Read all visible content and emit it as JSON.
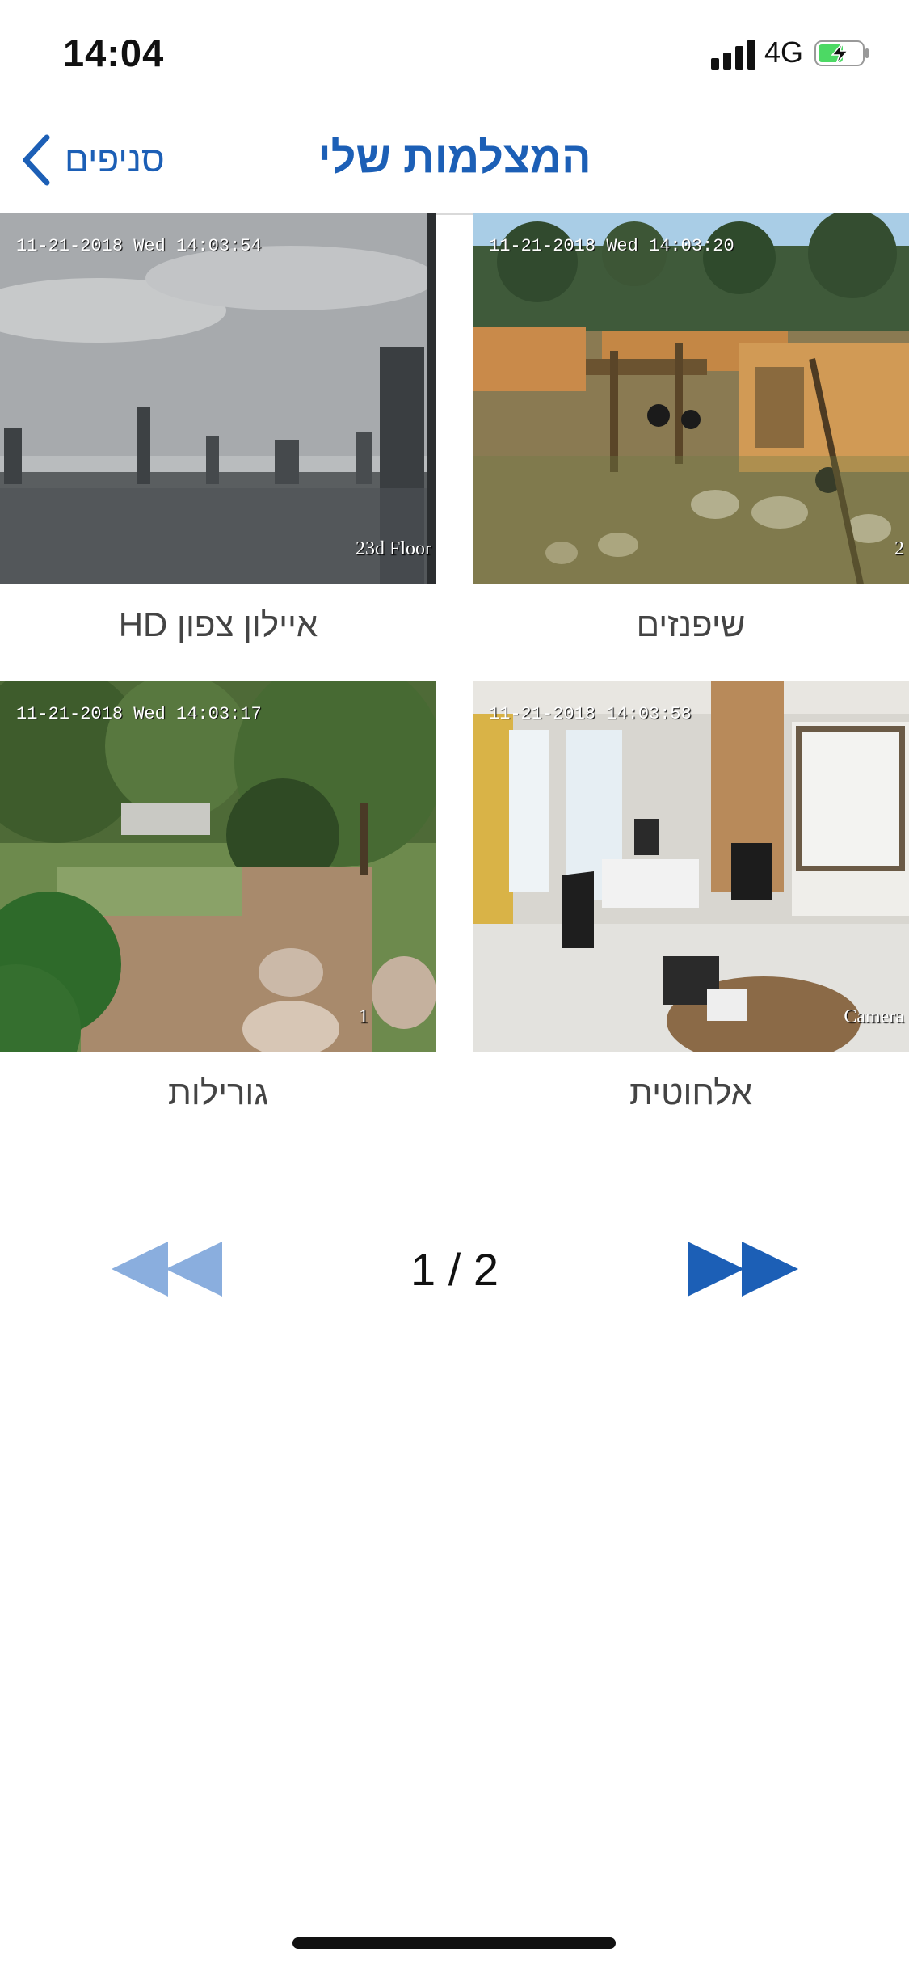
{
  "status": {
    "time": "14:04",
    "network": "4G"
  },
  "nav": {
    "title": "המצלמות שלי",
    "back_label": "סניפים"
  },
  "cameras": [
    {
      "label": "שיפנזים",
      "timestamp": "11-21-2018 Wed 14:03:20",
      "corner": "2"
    },
    {
      "label": "איילון צפון HD",
      "timestamp": "11-21-2018 Wed 14:03:54",
      "corner": "23d Floor"
    },
    {
      "label": "אלחוטית",
      "timestamp": "11-21-2018 14:03:58",
      "corner": "Camera"
    },
    {
      "label": "גורילות",
      "timestamp": "11-21-2018 Wed 14:03:17",
      "corner": "1"
    }
  ],
  "pager": {
    "page_text": "1 / 2"
  },
  "colors": {
    "accent": "#1c5fb6",
    "prev_disabled": "#8aaede"
  }
}
